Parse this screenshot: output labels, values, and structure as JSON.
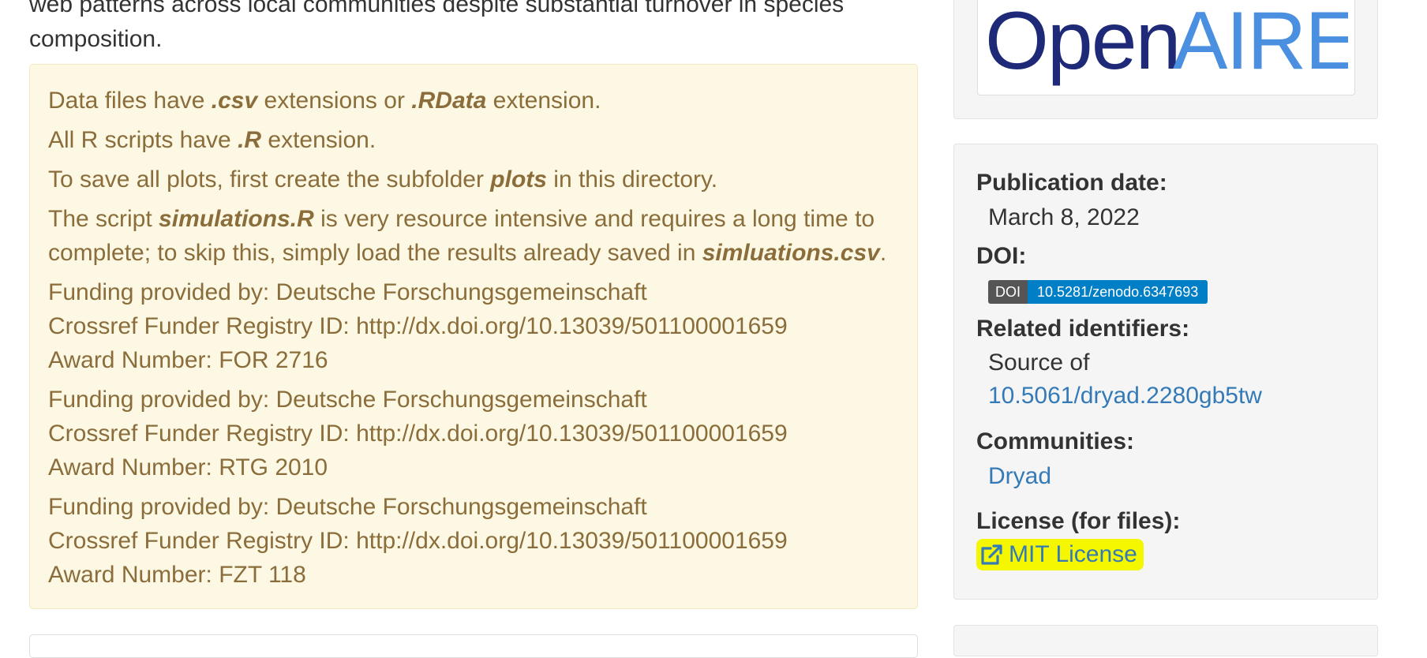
{
  "intro": {
    "line1": "web patterns across local communities despite substantial turnover in species",
    "line2": "composition."
  },
  "notes": {
    "data_files": [
      "Data files have ",
      ".csv",
      " extensions or ",
      ".RData",
      " extension."
    ],
    "r_scripts": [
      "All R scripts have ",
      ".R",
      " extension."
    ],
    "plots": [
      "To save all plots, first create the subfolder ",
      "plots",
      " in this directory."
    ],
    "sim_line1": [
      "The script ",
      "simulations.R",
      " is very resource intensive and requires a long time to"
    ],
    "sim_line2": [
      "complete; to skip this, simply load the results already saved in ",
      "simluations.csv",
      "."
    ],
    "funding": [
      {
        "provided_by": "Funding provided by: Deutsche Forschungsgemeinschaft",
        "registry": "Crossref Funder Registry ID: http://dx.doi.org/10.13039/501100001659",
        "award": "Award Number: FOR 2716"
      },
      {
        "provided_by": "Funding provided by: Deutsche Forschungsgemeinschaft",
        "registry": "Crossref Funder Registry ID: http://dx.doi.org/10.13039/501100001659",
        "award": "Award Number: RTG 2010"
      },
      {
        "provided_by": "Funding provided by: Deutsche Forschungsgemeinschaft",
        "registry": "Crossref Funder Registry ID: http://dx.doi.org/10.13039/501100001659",
        "award": "Award Number: FZT 118"
      }
    ]
  },
  "sidebar": {
    "logo": {
      "text_open": "Open",
      "text_aire": "AIRE",
      "color_open": "#1e2a78",
      "color_aire": "#4a8fe0"
    },
    "publication_date_label": "Publication date:",
    "publication_date": "March 8, 2022",
    "doi_label": "DOI:",
    "doi_badge_left": "DOI",
    "doi_badge_right": "10.5281/zenodo.6347693",
    "related_label": "Related identifiers:",
    "related_prefix": "Source of",
    "related_link": "10.5061/dryad.2280gb5tw",
    "communities_label": "Communities:",
    "community": "Dryad",
    "license_label": "License (for files):",
    "license": "MIT License",
    "license_icon": "external-link-icon",
    "highlight_color": "#f4f700"
  }
}
